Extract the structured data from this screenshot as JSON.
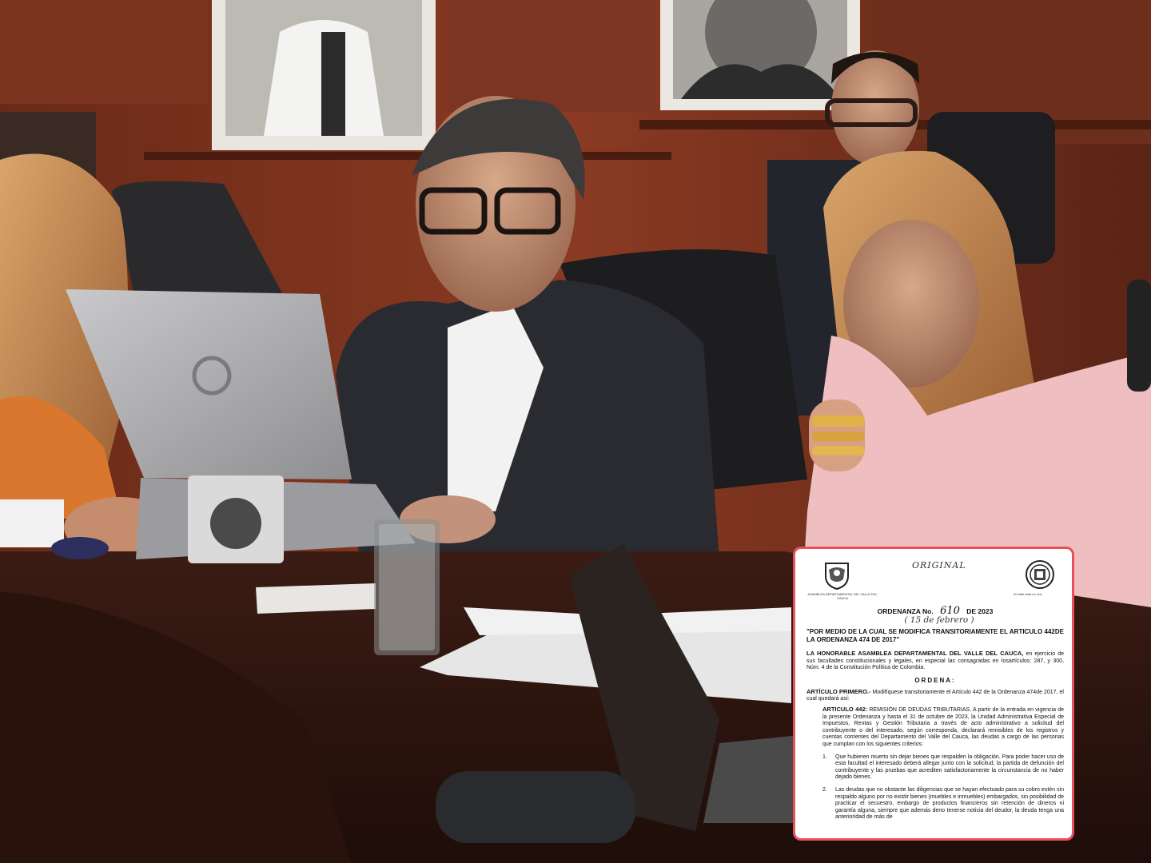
{
  "document": {
    "header_stamp": "ORIGINAL",
    "seal_left_caption": "ASAMBLEA DEPARTAMENTAL DEL VALLE DEL CAUCA",
    "seal_right_caption": "El Valle está en Vos",
    "ordinance_prefix": "ORDENANZA No.",
    "ordinance_number": "610",
    "ordinance_year": "DE 2023",
    "handwritten_date": "( 15 de febrero )",
    "title": "\"POR MEDIO DE LA CUAL SE MODIFICA TRANSITORIAMENTE EL ARTICULO 442DE LA ORDENANZA 474 DE 2017\"",
    "assembly_name": "LA HONORABLE ASAMBLEA DEPARTAMENTAL DEL VALLE DEL CAUCA,",
    "assembly_text": " en ejercicio de sus facultades constitucionales y legales, en especial las consagradas en losartículos: 287, y 300, Núm. 4 de la Constitución Política de Colombia.",
    "ordena": "ORDENA:",
    "article_first_label": "ARTÍCULO PRIMERO.-",
    "article_first_text": " Modifíquese transitoriamente el Artículo 442 de la Ordenanza 474de 2017, el cual quedará así:",
    "article_442_label": "ARTICULO 442:",
    "article_442_text": " REMISIÓN DE DEUDAS TRIBUTARIAS. A partir de la entrada en vigencia de la presente Ordenanza y hasta el 31 de octubre de 2023, la Unidad Administrativa Especial de Impuestos, Rentas y Gestión Tributaria a través de acto administrativo a solicitud del contribuyente o del interesado, según corresponda, declarará remisibles de los registros y cuentas corrientes del Departamento del Valle del Cauca, las deudas a cargo de las personas que cumplan con los siguientes criterios:",
    "items": [
      {
        "n": "1.",
        "text": "Que hubieren muerto sin dejar bienes que respalden la obligación. Para poder hacer uso de esta facultad el interesado deberá allegar junto con la solicitud, la partida de defunción del contribuyente y las pruebas que acrediten satisfactoriamente la circunstancia de no haber dejado bienes."
      },
      {
        "n": "2.",
        "text": "Las deudas que no obstante las diligencias que se hayan efectuado para su cobro estén sin respaldo alguno por no existir bienes (muebles e inmuebles) embargados, sin posibilidad de practicar el secuestro, embargo de productos financieros sin retención de dineros ni garantía alguna, siempre que además deno tenerse noticia del deudor, la deuda tenga una anterioridad de más de"
      }
    ]
  }
}
